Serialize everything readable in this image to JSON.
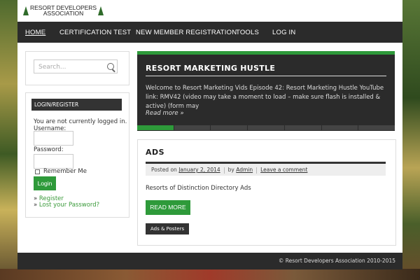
{
  "site": {
    "logo_line1": "RESORT DEVELOPERS",
    "logo_line2": "ASSOCIATION"
  },
  "nav": {
    "items": [
      {
        "label": "HOME"
      },
      {
        "label": "CERTIFICATION TEST"
      },
      {
        "label": "NEW MEMBER REGISTRATION"
      },
      {
        "label": "TOOLS"
      },
      {
        "label": "LOG IN"
      }
    ]
  },
  "search": {
    "placeholder": "Search..."
  },
  "login": {
    "title": "LOGIN/REGISTER",
    "status": "You are not currently logged in.",
    "username_label": "Username:",
    "password_label": "Password:",
    "remember_label": "Remember Me",
    "login_button": "Login",
    "register_prefix": "»",
    "register_link": "Register",
    "lost_prefix": "»",
    "lost_link": "Lost your Password?"
  },
  "slider": {
    "title": "RESORT MARKETING HUSTLE",
    "body": "Welcome to Resort Marketing Vids Episode 42: Resort Marketing Hustle YouTube link: RMV42 (video may take a moment to load – make sure flash is installed & active) (form may",
    "more": "Read more »",
    "active_slide": 1,
    "slide_count": 7
  },
  "post": {
    "title": "ADS",
    "posted_on_label": "Posted on",
    "date": "January 2, 2014",
    "by_label": "by",
    "author": "Admin",
    "comment_link": "Leave a comment",
    "excerpt": "Resorts of Distinction Directory Ads",
    "read_more": "READ MORE",
    "tag": "Ads & Posters"
  },
  "footer": {
    "copyright": "© Resort Developers Association 2010-2015"
  },
  "colors": {
    "accent": "#2e9a3a",
    "dark": "#2b2b2b"
  }
}
